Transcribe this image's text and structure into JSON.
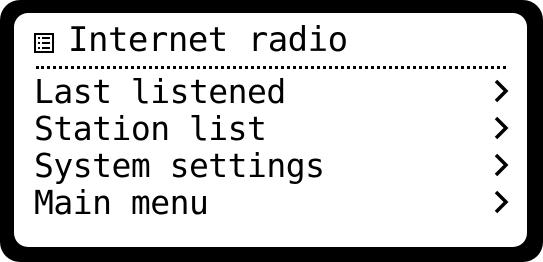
{
  "header": {
    "icon": "radio-list-icon",
    "title": "Internet radio"
  },
  "menu": {
    "items": [
      {
        "label": "Last listened",
        "icon": "chevron-right-icon"
      },
      {
        "label": "Station list",
        "icon": "chevron-right-icon"
      },
      {
        "label": "System settings",
        "icon": "chevron-right-icon"
      },
      {
        "label": "Main menu",
        "icon": "chevron-right-icon"
      }
    ]
  },
  "colors": {
    "bezel": "#000000",
    "screen": "#ffffff",
    "text": "#000000"
  }
}
